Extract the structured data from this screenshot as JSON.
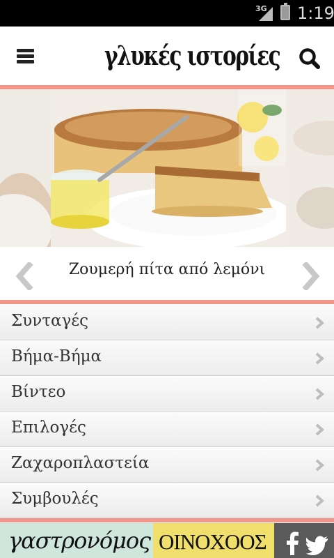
{
  "status_bar": {
    "network": "3G",
    "time": "1:19"
  },
  "header": {
    "logo_text": "γλυκές ιστορίες",
    "menu_icon": "hamburger-menu-icon",
    "search_icon": "search-icon"
  },
  "carousel": {
    "caption": "Ζουμερή πίτα από λεμόνι",
    "prev_icon": "chevron-left-icon",
    "next_icon": "chevron-right-icon"
  },
  "menu": {
    "items": [
      {
        "label": "Συνταγές"
      },
      {
        "label": "Βήμα-Βήμα"
      },
      {
        "label": "Βίντεο"
      },
      {
        "label": "Επιλογές"
      },
      {
        "label": "Ζαχαροπλαστεία"
      },
      {
        "label": "Συμβουλές"
      }
    ]
  },
  "banner": {
    "gastronomos": "γαστρονόμος",
    "oinochoos": "ΟΙΝΟΧΟΟΣ"
  },
  "colors": {
    "accent": "#f4958a",
    "gastronomos_bg": "#cfe6dc",
    "oinochoos_bg": "#f0df6c",
    "social_bg": "#5a5a5a"
  }
}
